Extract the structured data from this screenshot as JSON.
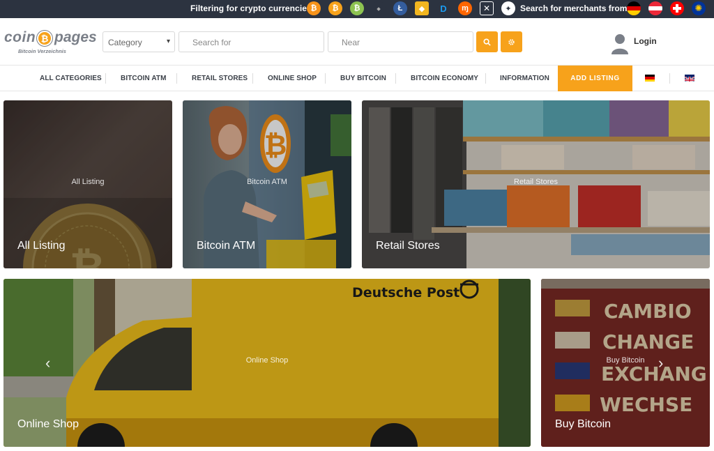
{
  "topbar": {
    "filter_text": "Filtering for crypto currencies:",
    "merchants_text": "Search for merchants from:",
    "coins": [
      {
        "icon": "bitcoin-icon",
        "glyph": "₿",
        "color": "#f7931a"
      },
      {
        "icon": "bitcoin-cash-icon",
        "glyph": "₿",
        "color": "#f7a21b"
      },
      {
        "icon": "bitcoin-sv-icon",
        "glyph": "₿",
        "color": "#8dc351"
      },
      {
        "icon": "ethereum-icon",
        "glyph": "⬩",
        "color": "#2c3340"
      },
      {
        "icon": "litecoin-icon",
        "glyph": "Ł",
        "color": "#345d9d"
      },
      {
        "icon": "bitcoin-diamond-icon",
        "glyph": "◆",
        "color": "#f2b620"
      },
      {
        "icon": "dash-icon",
        "glyph": "D",
        "color": "#1c75bc"
      },
      {
        "icon": "monero-icon",
        "glyph": "ɱ",
        "color": "#ff6600"
      },
      {
        "icon": "nem-icon",
        "glyph": "✕",
        "color": "#2c3340"
      },
      {
        "icon": "stellar-icon",
        "glyph": "✦",
        "color": "#ffffff"
      }
    ],
    "countries": [
      {
        "icon": "germany-flag-icon"
      },
      {
        "icon": "austria-flag-icon"
      },
      {
        "icon": "switzerland-flag-icon"
      },
      {
        "icon": "eu-flag-icon"
      }
    ]
  },
  "header": {
    "logo_word1": "coin",
    "logo_word2": "pages",
    "logo_sub": "Bitcoin Verzeichnis",
    "category_value": "Category",
    "search_placeholder": "Search for",
    "near_placeholder": "Near",
    "login_label": "Login"
  },
  "nav": {
    "items": [
      "ALL CATEGORIES",
      "BITCOIN ATM",
      "RETAIL STORES",
      "ONLINE SHOP",
      "BUY BITCOIN",
      "BITCOIN ECONOMY",
      "INFORMATION"
    ],
    "add_listing": "ADD LISTING"
  },
  "tiles": [
    {
      "label": "All Listing",
      "center": "All Listing"
    },
    {
      "label": "Bitcoin ATM",
      "center": "Bitcoin ATM"
    },
    {
      "label": "Retail Stores",
      "center": "Retail Stores"
    },
    {
      "label": "Online Shop",
      "center": "Online Shop"
    },
    {
      "label": "Buy Bitcoin",
      "center": "Buy Bitcoin"
    }
  ],
  "van_text": "Deutsche Post",
  "sign_lines": [
    "CAMBIO",
    "CHANGE",
    "EXCHANG",
    "WECHSE"
  ]
}
